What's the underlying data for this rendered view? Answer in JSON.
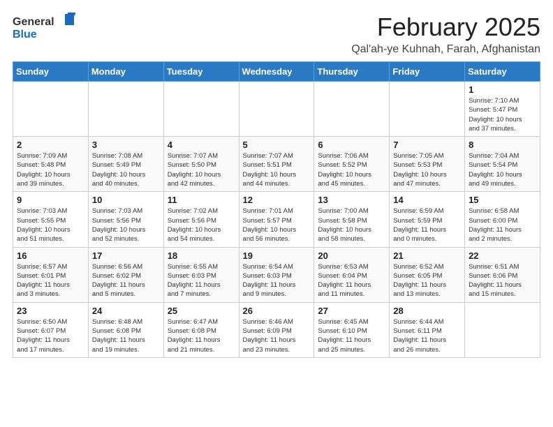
{
  "header": {
    "logo_general": "General",
    "logo_blue": "Blue",
    "month": "February 2025",
    "location": "Qal'ah-ye Kuhnah, Farah, Afghanistan"
  },
  "weekdays": [
    "Sunday",
    "Monday",
    "Tuesday",
    "Wednesday",
    "Thursday",
    "Friday",
    "Saturday"
  ],
  "weeks": [
    [
      {
        "day": "",
        "info": ""
      },
      {
        "day": "",
        "info": ""
      },
      {
        "day": "",
        "info": ""
      },
      {
        "day": "",
        "info": ""
      },
      {
        "day": "",
        "info": ""
      },
      {
        "day": "",
        "info": ""
      },
      {
        "day": "1",
        "info": "Sunrise: 7:10 AM\nSunset: 5:47 PM\nDaylight: 10 hours\nand 37 minutes."
      }
    ],
    [
      {
        "day": "2",
        "info": "Sunrise: 7:09 AM\nSunset: 5:48 PM\nDaylight: 10 hours\nand 39 minutes."
      },
      {
        "day": "3",
        "info": "Sunrise: 7:08 AM\nSunset: 5:49 PM\nDaylight: 10 hours\nand 40 minutes."
      },
      {
        "day": "4",
        "info": "Sunrise: 7:07 AM\nSunset: 5:50 PM\nDaylight: 10 hours\nand 42 minutes."
      },
      {
        "day": "5",
        "info": "Sunrise: 7:07 AM\nSunset: 5:51 PM\nDaylight: 10 hours\nand 44 minutes."
      },
      {
        "day": "6",
        "info": "Sunrise: 7:06 AM\nSunset: 5:52 PM\nDaylight: 10 hours\nand 45 minutes."
      },
      {
        "day": "7",
        "info": "Sunrise: 7:05 AM\nSunset: 5:53 PM\nDaylight: 10 hours\nand 47 minutes."
      },
      {
        "day": "8",
        "info": "Sunrise: 7:04 AM\nSunset: 5:54 PM\nDaylight: 10 hours\nand 49 minutes."
      }
    ],
    [
      {
        "day": "9",
        "info": "Sunrise: 7:03 AM\nSunset: 5:55 PM\nDaylight: 10 hours\nand 51 minutes."
      },
      {
        "day": "10",
        "info": "Sunrise: 7:03 AM\nSunset: 5:56 PM\nDaylight: 10 hours\nand 52 minutes."
      },
      {
        "day": "11",
        "info": "Sunrise: 7:02 AM\nSunset: 5:56 PM\nDaylight: 10 hours\nand 54 minutes."
      },
      {
        "day": "12",
        "info": "Sunrise: 7:01 AM\nSunset: 5:57 PM\nDaylight: 10 hours\nand 56 minutes."
      },
      {
        "day": "13",
        "info": "Sunrise: 7:00 AM\nSunset: 5:58 PM\nDaylight: 10 hours\nand 58 minutes."
      },
      {
        "day": "14",
        "info": "Sunrise: 6:59 AM\nSunset: 5:59 PM\nDaylight: 11 hours\nand 0 minutes."
      },
      {
        "day": "15",
        "info": "Sunrise: 6:58 AM\nSunset: 6:00 PM\nDaylight: 11 hours\nand 2 minutes."
      }
    ],
    [
      {
        "day": "16",
        "info": "Sunrise: 6:57 AM\nSunset: 6:01 PM\nDaylight: 11 hours\nand 3 minutes."
      },
      {
        "day": "17",
        "info": "Sunrise: 6:56 AM\nSunset: 6:02 PM\nDaylight: 11 hours\nand 5 minutes."
      },
      {
        "day": "18",
        "info": "Sunrise: 6:55 AM\nSunset: 6:03 PM\nDaylight: 11 hours\nand 7 minutes."
      },
      {
        "day": "19",
        "info": "Sunrise: 6:54 AM\nSunset: 6:03 PM\nDaylight: 11 hours\nand 9 minutes."
      },
      {
        "day": "20",
        "info": "Sunrise: 6:53 AM\nSunset: 6:04 PM\nDaylight: 11 hours\nand 11 minutes."
      },
      {
        "day": "21",
        "info": "Sunrise: 6:52 AM\nSunset: 6:05 PM\nDaylight: 11 hours\nand 13 minutes."
      },
      {
        "day": "22",
        "info": "Sunrise: 6:51 AM\nSunset: 6:06 PM\nDaylight: 11 hours\nand 15 minutes."
      }
    ],
    [
      {
        "day": "23",
        "info": "Sunrise: 6:50 AM\nSunset: 6:07 PM\nDaylight: 11 hours\nand 17 minutes."
      },
      {
        "day": "24",
        "info": "Sunrise: 6:48 AM\nSunset: 6:08 PM\nDaylight: 11 hours\nand 19 minutes."
      },
      {
        "day": "25",
        "info": "Sunrise: 6:47 AM\nSunset: 6:08 PM\nDaylight: 11 hours\nand 21 minutes."
      },
      {
        "day": "26",
        "info": "Sunrise: 6:46 AM\nSunset: 6:09 PM\nDaylight: 11 hours\nand 23 minutes."
      },
      {
        "day": "27",
        "info": "Sunrise: 6:45 AM\nSunset: 6:10 PM\nDaylight: 11 hours\nand 25 minutes."
      },
      {
        "day": "28",
        "info": "Sunrise: 6:44 AM\nSunset: 6:11 PM\nDaylight: 11 hours\nand 26 minutes."
      },
      {
        "day": "",
        "info": ""
      }
    ]
  ]
}
